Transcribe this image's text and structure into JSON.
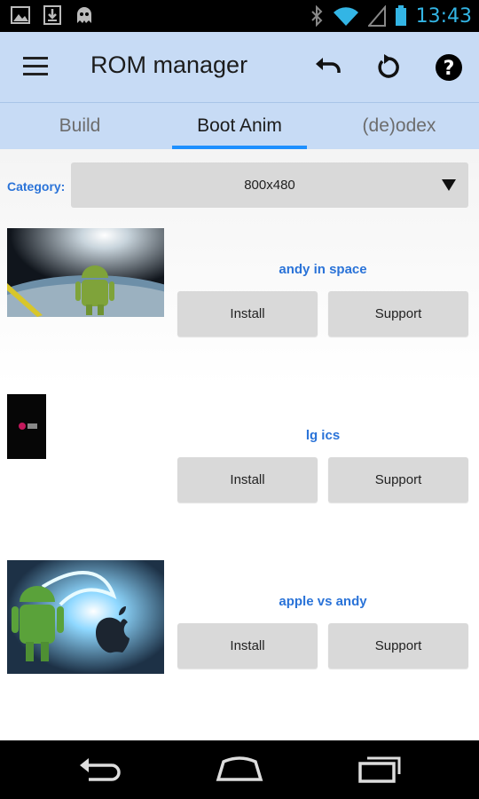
{
  "status_bar": {
    "time": "13:43",
    "icons": [
      "image-icon",
      "download-icon",
      "ghost-icon",
      "bluetooth-icon",
      "wifi-icon",
      "signal-icon",
      "battery-icon"
    ]
  },
  "action_bar": {
    "title": "ROM manager",
    "actions": [
      "undo-icon",
      "refresh-icon",
      "help-icon"
    ]
  },
  "tabs": [
    {
      "label": "Build",
      "active": false
    },
    {
      "label": "Boot Anim",
      "active": true
    },
    {
      "label": "(de)odex",
      "active": false
    }
  ],
  "category": {
    "label": "Category:",
    "value": "800x480"
  },
  "items": [
    {
      "name": "andy in space",
      "install_label": "Install",
      "support_label": "Support"
    },
    {
      "name": "lg ics",
      "install_label": "Install",
      "support_label": "Support"
    },
    {
      "name": "apple vs andy",
      "install_label": "Install",
      "support_label": "Support"
    }
  ],
  "nav_bar": [
    "back-icon",
    "home-icon",
    "recents-icon"
  ],
  "colors": {
    "accent": "#2a73d8",
    "action_bar": "#c7dbf5",
    "tab_indicator": "#1e90ff",
    "status_time": "#33b5e5"
  }
}
